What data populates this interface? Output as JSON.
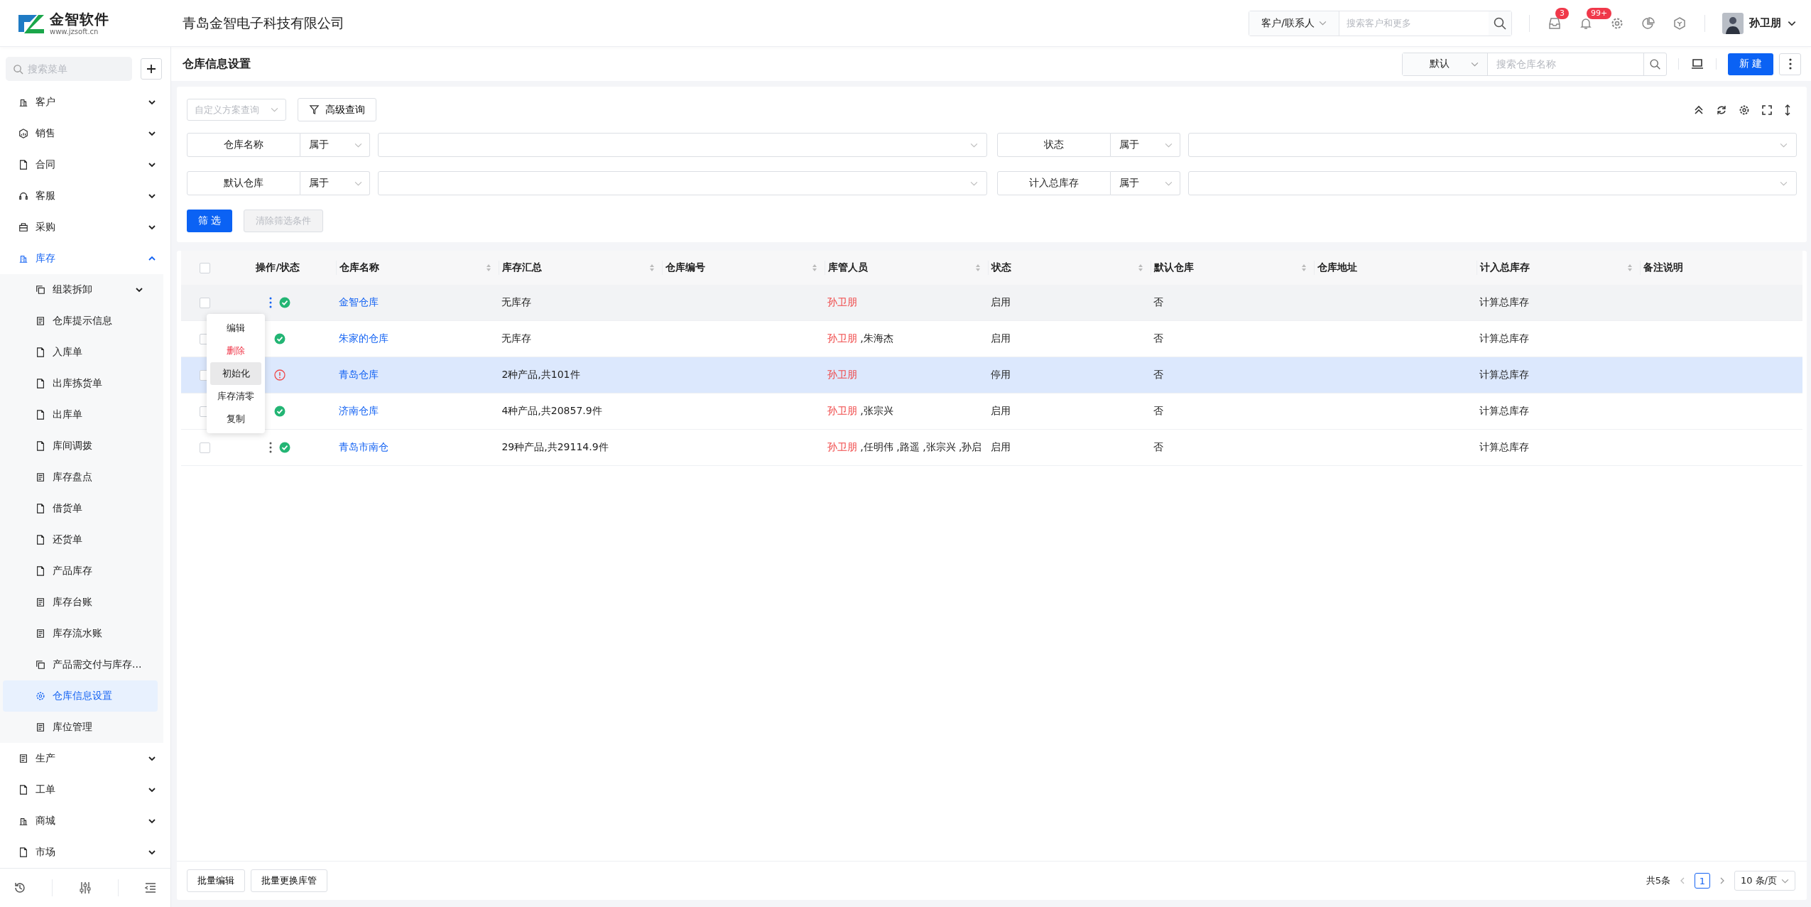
{
  "header": {
    "logo": {
      "name": "金智软件",
      "url": "www.jzsoft.cn"
    },
    "company": "青岛金智电子科技有限公司",
    "search": {
      "scope": "客户/联系人",
      "placeholder": "搜索客户和更多"
    },
    "tools": [
      {
        "kind": "inbox",
        "badge": "3"
      },
      {
        "kind": "bell",
        "badge": "99+"
      },
      {
        "kind": "settings"
      },
      {
        "kind": "chart"
      },
      {
        "kind": "cube"
      }
    ],
    "user": {
      "name": "孙卫朋"
    }
  },
  "sidebar": {
    "search": {
      "placeholder": "搜索菜单"
    },
    "items": [
      {
        "label": "客户",
        "expanded": false,
        "selected": false
      },
      {
        "label": "销售",
        "expanded": false,
        "selected": false
      },
      {
        "label": "合同",
        "expanded": false,
        "selected": false
      },
      {
        "label": "客服",
        "expanded": false,
        "selected": false
      },
      {
        "label": "采购",
        "expanded": false,
        "selected": false
      },
      {
        "label": "库存",
        "expanded": true,
        "selected": false,
        "children": [
          {
            "label": "组装拆卸",
            "expanded": false,
            "selected": false
          },
          {
            "label": "仓库提示信息",
            "selected": false
          },
          {
            "label": "入库单",
            "selected": false
          },
          {
            "label": "出库拣货单",
            "selected": false
          },
          {
            "label": "出库单",
            "selected": false
          },
          {
            "label": "库间调拨",
            "selected": false
          },
          {
            "label": "库存盘点",
            "selected": false
          },
          {
            "label": "借货单",
            "selected": false
          },
          {
            "label": "还货单",
            "selected": false
          },
          {
            "label": "产品库存",
            "selected": false
          },
          {
            "label": "库存台账",
            "selected": false
          },
          {
            "label": "库存流水账",
            "selected": false
          },
          {
            "label": "产品需交付与库存...",
            "selected": false
          },
          {
            "label": "仓库信息设置",
            "selected": true
          },
          {
            "label": "库位管理",
            "selected": false
          }
        ]
      },
      {
        "label": "生产",
        "expanded": false,
        "selected": false
      },
      {
        "label": "工单",
        "expanded": false,
        "selected": false
      },
      {
        "label": "商城",
        "expanded": false,
        "selected": false
      },
      {
        "label": "市场",
        "expanded": false,
        "selected": false
      }
    ]
  },
  "page": {
    "title": "仓库信息设置",
    "view": "默认",
    "search": {
      "placeholder": "搜索仓库名称"
    },
    "new_button": "新 建"
  },
  "filter": {
    "scheme": {
      "placeholder": "自定义方案查询"
    },
    "advanced": "高级查询",
    "conditions": [
      {
        "field": "仓库名称",
        "operator": "属于"
      },
      {
        "field": "状态",
        "operator": "属于"
      },
      {
        "field": "默认仓库",
        "operator": "属于"
      },
      {
        "field": "计入总库存",
        "operator": "属于"
      }
    ],
    "apply": "筛 选",
    "clear": {
      "label": "清除筛选条件",
      "disabled": true
    }
  },
  "table": {
    "all_checked": false,
    "columns": [
      {
        "label": "操作/状态",
        "sortable": false
      },
      {
        "label": "仓库名称",
        "sortable": true
      },
      {
        "label": "库存汇总",
        "sortable": true
      },
      {
        "label": "仓库编号",
        "sortable": true
      },
      {
        "label": "库管人员",
        "sortable": true
      },
      {
        "label": "状态",
        "sortable": true
      },
      {
        "label": "默认仓库",
        "sortable": true
      },
      {
        "label": "仓库地址",
        "sortable": false
      },
      {
        "label": "计入总库存",
        "sortable": true
      },
      {
        "label": "备注说明",
        "sortable": false
      }
    ],
    "rows": [
      {
        "checked": false,
        "selected": false,
        "hovered": true,
        "menu_open": true,
        "ok": true,
        "name": "金智仓库",
        "summary": "无库存",
        "manager": "孙卫朋",
        "status": "启用",
        "default": "否",
        "include": "计算总库存"
      },
      {
        "checked": false,
        "selected": false,
        "hovered": false,
        "menu_open": false,
        "ok": true,
        "name": "朱家的仓库",
        "summary": "无库存",
        "manager": "孙卫朋",
        "others": ",朱海杰",
        "status": "启用",
        "default": "否",
        "include": "计算总库存"
      },
      {
        "checked": false,
        "selected": true,
        "hovered": false,
        "menu_open": false,
        "ok": false,
        "name": "青岛仓库",
        "summary": "2种产品,共101件",
        "manager": "孙卫朋",
        "status": "停用",
        "default": "否",
        "include": "计算总库存"
      },
      {
        "checked": false,
        "selected": false,
        "hovered": false,
        "menu_open": false,
        "ok": true,
        "name": "济南仓库",
        "summary": "4种产品,共20857.9件",
        "manager": "孙卫朋",
        "others": ",张宗兴",
        "status": "启用",
        "default": "否",
        "include": "计算总库存"
      },
      {
        "checked": false,
        "selected": false,
        "hovered": false,
        "menu_open": false,
        "ok": true,
        "name": "青岛市南仓",
        "summary": "29种产品,共29114.9件",
        "manager": "孙卫朋",
        "others": ",任明伟 ,路遥 ,张宗兴 ,孙启",
        "status": "启用",
        "default": "否",
        "include": "计算总库存"
      }
    ],
    "row_menu": [
      {
        "label": "编辑",
        "kind": "normal",
        "selected": false
      },
      {
        "label": "删除",
        "kind": "danger",
        "selected": false
      },
      {
        "label": "初始化",
        "kind": "normal",
        "selected": true
      },
      {
        "label": "库存清零",
        "kind": "normal",
        "selected": false
      },
      {
        "label": "复制",
        "kind": "normal",
        "selected": false
      }
    ]
  },
  "footer": {
    "buttons": [
      "批量编辑",
      "批量更换库管"
    ],
    "total": "共5条",
    "pages": [
      {
        "label": "1",
        "selected": true
      }
    ],
    "page_size": "10 条/页"
  }
}
